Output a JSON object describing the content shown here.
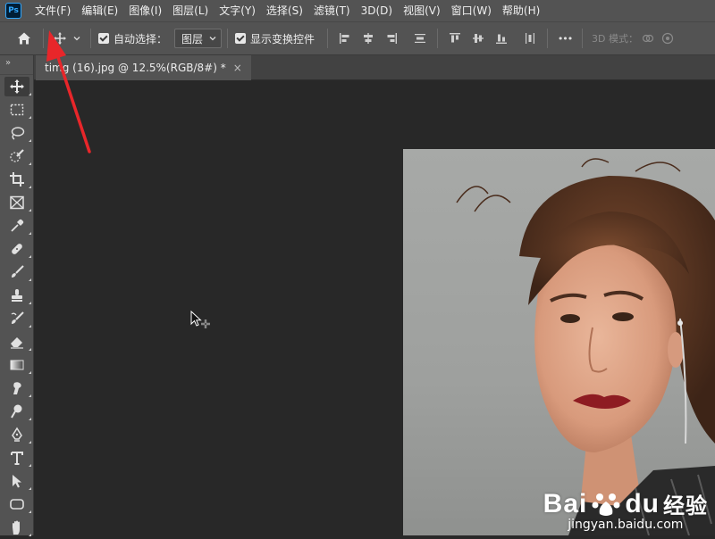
{
  "app": {
    "logo": "Ps"
  },
  "menu": [
    "文件(F)",
    "编辑(E)",
    "图像(I)",
    "图层(L)",
    "文字(Y)",
    "选择(S)",
    "滤镜(T)",
    "3D(D)",
    "视图(V)",
    "窗口(W)",
    "帮助(H)"
  ],
  "options": {
    "auto_select_label": "自动选择：",
    "auto_select_value": "图层",
    "show_transform_label": "显示变换控件",
    "more_label": "•••",
    "mode_label": "3D 模式："
  },
  "toolbar": {
    "grip": "»"
  },
  "tabs": [
    {
      "title": "timg (16).jpg @ 12.5%(RGB/8#) *",
      "close": "×"
    }
  ],
  "watermark": {
    "brand_bai": "Bai",
    "brand_du": "du",
    "brand_jy": "经验",
    "url": "jingyan.baidu.com"
  },
  "colors": {
    "accent_arrow": "#e8262a",
    "ps_blue": "#31a8ff"
  }
}
